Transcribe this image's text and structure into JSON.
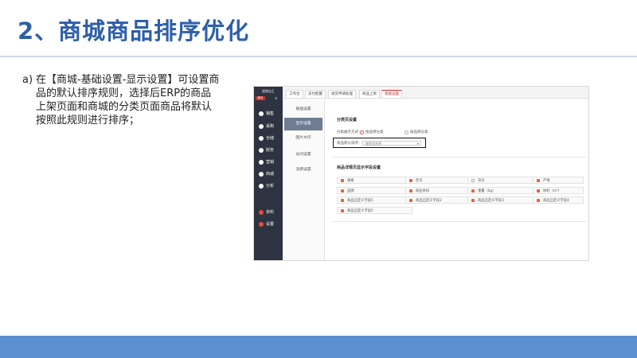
{
  "slide": {
    "title": "2、商城商品排序优化",
    "bullet_mark": "a)",
    "bullet_text": "在【商城-基础设置-显示设置】可设置商品的默认排序规则，选择后ERP的商品上架页面和商城的分类页面商品将默认按照此规则进行排序；"
  },
  "app": {
    "logo": "双岗企汇",
    "logo_badge": "首页",
    "nav": [
      {
        "label": "销售",
        "icon": "cart-icon"
      },
      {
        "label": "采购",
        "icon": "apple-icon"
      },
      {
        "label": "仓储",
        "icon": "warehouse-icon"
      },
      {
        "label": "财务",
        "icon": "chart-icon"
      },
      {
        "label": "营销",
        "icon": "chat-icon"
      },
      {
        "label": "商城",
        "icon": "shop-icon"
      },
      {
        "label": "分析",
        "icon": "target-icon"
      },
      {
        "label": "资料",
        "icon": "folder-icon"
      },
      {
        "label": "设置",
        "icon": "gear-icon"
      }
    ],
    "tabs": [
      "工作台",
      "支付配置",
      "退货申请处理",
      "商品上架",
      "基础设置"
    ],
    "submenu": [
      "基础设置",
      "显示设置",
      "图片水印",
      "访问设置",
      "消费设置"
    ],
    "display": {
      "section_title": "分类页设置",
      "mode_label": "分类展示方式：",
      "mode_options": [
        "按品牌分类",
        "按品牌分类"
      ],
      "sort_label": "商品默认排序：",
      "sort_value": "按货号升序"
    },
    "fields": {
      "section_title": "商品详情页显示字段设置",
      "items": [
        {
          "label": "规格",
          "checked": true
        },
        {
          "label": "型号",
          "checked": true
        },
        {
          "label": "货号",
          "checked": false
        },
        {
          "label": "产地",
          "checked": true
        },
        {
          "label": "品牌",
          "checked": true
        },
        {
          "label": "商品条码",
          "checked": true
        },
        {
          "label": "重量（kg）",
          "checked": true
        },
        {
          "label": "体积（m³）",
          "checked": true
        },
        {
          "label": "商品自定义字段1",
          "checked": true
        },
        {
          "label": "商品自定义字段2",
          "checked": true
        },
        {
          "label": "商品自定义字段3",
          "checked": true
        },
        {
          "label": "商品自定义字段4",
          "checked": true
        },
        {
          "label": "商品自定义字段5",
          "checked": true
        }
      ]
    }
  }
}
